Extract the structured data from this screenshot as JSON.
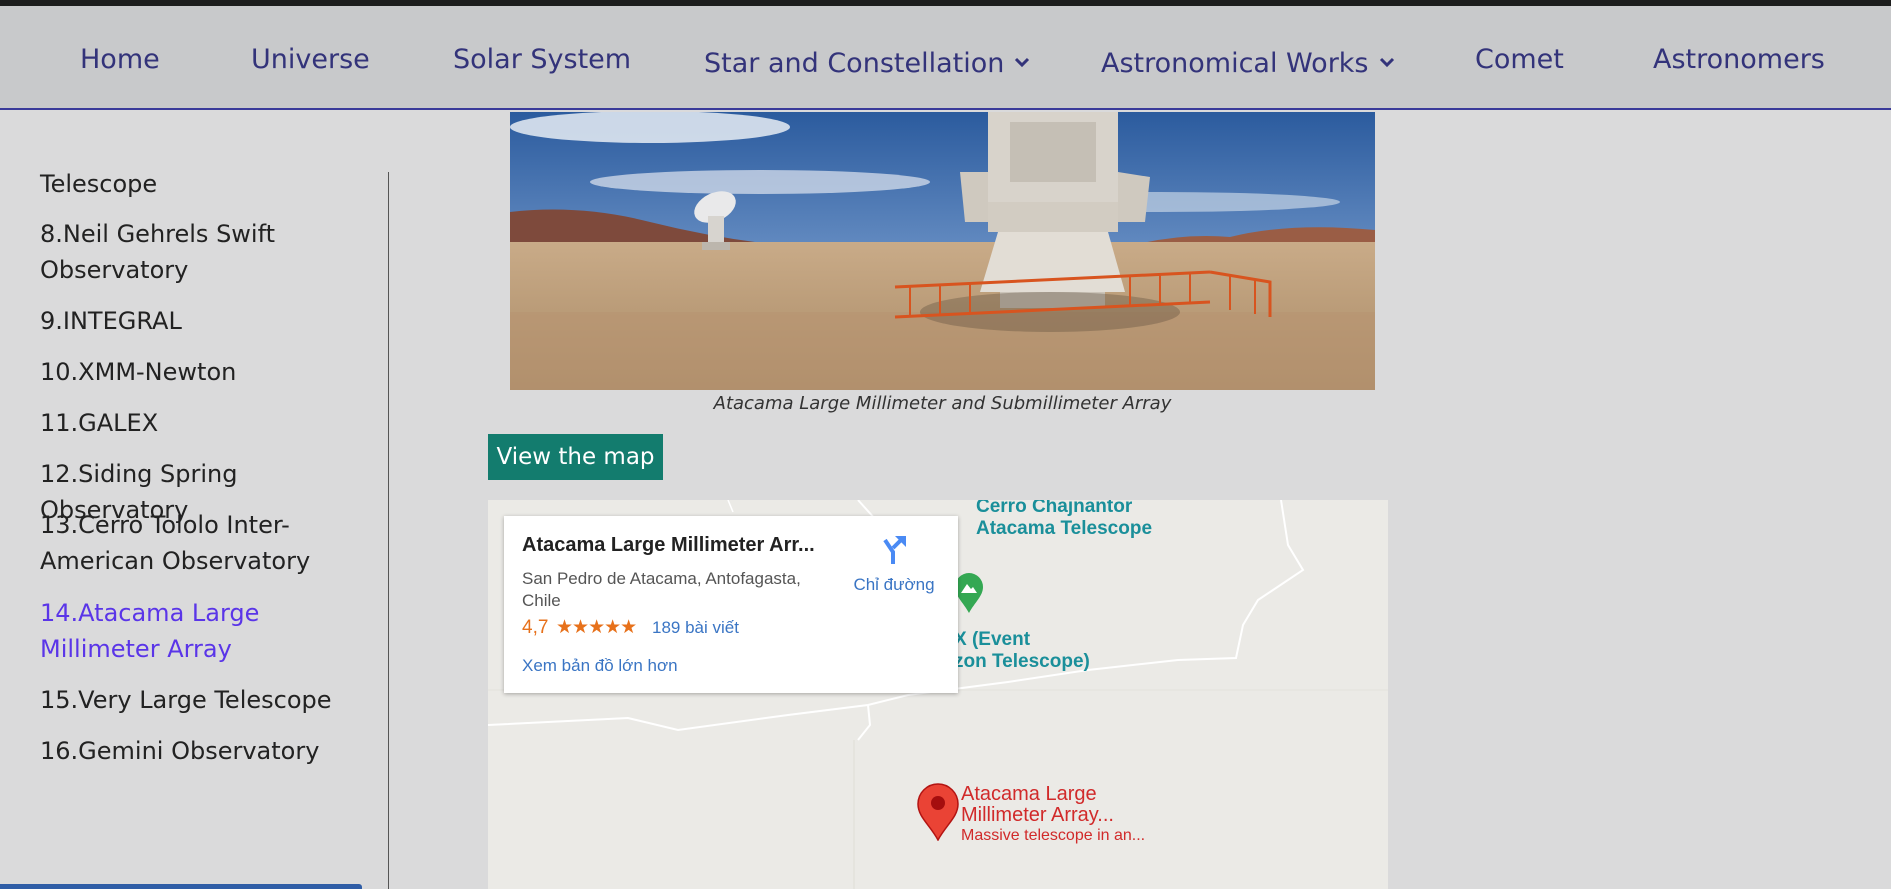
{
  "nav": {
    "items": [
      {
        "label": "Home",
        "dropdown": false
      },
      {
        "label": "Universe",
        "dropdown": false
      },
      {
        "label": "Solar System",
        "dropdown": false
      },
      {
        "label": "Star and Constellation",
        "dropdown": true
      },
      {
        "label": "Astronomical Works",
        "dropdown": true
      },
      {
        "label": "Comet",
        "dropdown": false
      },
      {
        "label": "Astronomers",
        "dropdown": false
      }
    ]
  },
  "sidebar": {
    "items": [
      {
        "label": "Telescope",
        "active": false
      },
      {
        "label": "8.Neil Gehrels Swift Observatory",
        "active": false
      },
      {
        "label": "9.INTEGRAL",
        "active": false
      },
      {
        "label": "10.XMM-Newton",
        "active": false
      },
      {
        "label": "11.GALEX",
        "active": false
      },
      {
        "label": "12.Siding Spring Observatory",
        "active": false
      },
      {
        "label": "13.Cerro Tololo Inter-American Observatory",
        "active": false
      },
      {
        "label": "14.Atacama Large Millimeter Array",
        "active": true
      },
      {
        "label": "15.Very Large Telescope",
        "active": false
      },
      {
        "label": "16.Gemini Observatory",
        "active": false
      }
    ]
  },
  "main": {
    "image_caption": "Atacama Large Millimeter and Submillimeter Array",
    "map_button_label": "View the map"
  },
  "map": {
    "card": {
      "title": "Atacama Large Millimeter Arr...",
      "address": "San Pedro de Atacama, Antofagasta, Chile",
      "rating": "4,7",
      "stars": "★★★★★",
      "reviews": "189 bài viết",
      "directions": "Chỉ đường",
      "larger_map": "Xem bản đồ lớn hơn"
    },
    "labels": {
      "top_line1": "Cerro Chajnantor",
      "top_line2": "Atacama Telescope",
      "mid_line1": "X (Event",
      "mid_line2": "zon Telescope)"
    },
    "pin": {
      "line1": "Atacama Large",
      "line2": "Millimeter Array...",
      "line3": "Massive telescope in an..."
    }
  },
  "colors": {
    "nav_text": "#33337a",
    "active_link": "#5a35e8",
    "button_bg": "#137c6e",
    "map_link": "#3a75c4",
    "pin_red": "#d12a2a"
  }
}
